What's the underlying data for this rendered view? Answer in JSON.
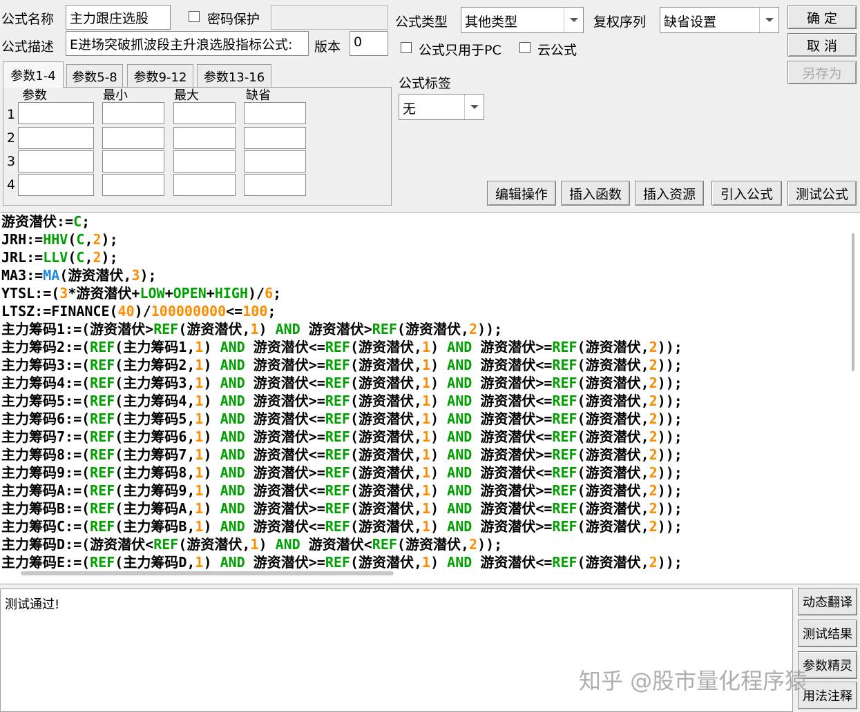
{
  "header": {
    "name_label": "公式名称",
    "name_value": "主力跟庄选股",
    "password_label": "密码保护",
    "password_value": "",
    "desc_label": "公式描述",
    "desc_value": "E进场突破抓波段主升浪选股指标公式:",
    "version_label": "版本",
    "version_value": "0",
    "type_label": "公式类型",
    "type_value": "其他类型",
    "rights_label": "复权序列",
    "rights_value": "缺省设置",
    "pc_only_label": "公式只用于PC",
    "cloud_label": "云公式",
    "tag_label": "公式标签",
    "tag_value": "无"
  },
  "buttons": {
    "ok": "确 定",
    "cancel": "取 消",
    "save_as": "另存为",
    "edit_op": "编辑操作",
    "insert_func": "插入函数",
    "insert_res": "插入资源",
    "import_formula": "引入公式",
    "test_formula": "测试公式"
  },
  "params": {
    "tabs": [
      "参数1-4",
      "参数5-8",
      "参数9-12",
      "参数13-16"
    ],
    "active_tab": 0,
    "col_headers": [
      "参数",
      "最小",
      "最大",
      "缺省"
    ],
    "rows": [
      "1",
      "2",
      "3",
      "4"
    ]
  },
  "code": {
    "colors": {
      "func": "#00a000",
      "num": "#ff8c00",
      "ma": "#1e88e5",
      "text": "#000000"
    },
    "lines": [
      [
        [
          "游资潜伏:=",
          "t"
        ],
        [
          "C",
          "f"
        ],
        [
          ";",
          "t"
        ]
      ],
      [
        [
          "JRH:=",
          "t"
        ],
        [
          "HHV",
          "f"
        ],
        [
          "(",
          "t"
        ],
        [
          "C",
          "f"
        ],
        [
          ",",
          "t"
        ],
        [
          "2",
          "n"
        ],
        [
          ");",
          "t"
        ]
      ],
      [
        [
          "JRL:=",
          "t"
        ],
        [
          "LLV",
          "f"
        ],
        [
          "(",
          "t"
        ],
        [
          "C",
          "f"
        ],
        [
          ",",
          "t"
        ],
        [
          "2",
          "n"
        ],
        [
          ");",
          "t"
        ]
      ],
      [
        [
          "MA3:=",
          "t"
        ],
        [
          "MA",
          "m"
        ],
        [
          "(游资潜伏,",
          "t"
        ],
        [
          "3",
          "n"
        ],
        [
          ");",
          "t"
        ]
      ],
      [
        [
          "YTSL:=(",
          "t"
        ],
        [
          "3",
          "n"
        ],
        [
          "*游资潜伏+",
          "t"
        ],
        [
          "LOW",
          "f"
        ],
        [
          "+",
          "t"
        ],
        [
          "OPEN",
          "f"
        ],
        [
          "+",
          "t"
        ],
        [
          "HIGH",
          "f"
        ],
        [
          ")/",
          "t"
        ],
        [
          "6",
          "n"
        ],
        [
          ";",
          "t"
        ]
      ],
      [
        [
          "LTSZ:=FINANCE(",
          "t"
        ],
        [
          "40",
          "n"
        ],
        [
          ")/",
          "t"
        ],
        [
          "100000000",
          "n"
        ],
        [
          "<=",
          "t"
        ],
        [
          "100",
          "n"
        ],
        [
          ";",
          "t"
        ]
      ],
      [
        [
          "主力筹码1:=(游资潜伏>",
          "t"
        ],
        [
          "REF",
          "f"
        ],
        [
          "(游资潜伏,",
          "t"
        ],
        [
          "1",
          "n"
        ],
        [
          ") ",
          "t"
        ],
        [
          "AND",
          "f"
        ],
        [
          " 游资潜伏>",
          "t"
        ],
        [
          "REF",
          "f"
        ],
        [
          "(游资潜伏,",
          "t"
        ],
        [
          "2",
          "n"
        ],
        [
          "));",
          "t"
        ]
      ],
      [
        [
          "主力筹码2:=(",
          "t"
        ],
        [
          "REF",
          "f"
        ],
        [
          "(主力筹码1,",
          "t"
        ],
        [
          "1",
          "n"
        ],
        [
          ") ",
          "t"
        ],
        [
          "AND",
          "f"
        ],
        [
          " 游资潜伏<=",
          "t"
        ],
        [
          "REF",
          "f"
        ],
        [
          "(游资潜伏,",
          "t"
        ],
        [
          "1",
          "n"
        ],
        [
          ") ",
          "t"
        ],
        [
          "AND",
          "f"
        ],
        [
          " 游资潜伏>=",
          "t"
        ],
        [
          "REF",
          "f"
        ],
        [
          "(游资潜伏,",
          "t"
        ],
        [
          "2",
          "n"
        ],
        [
          "));",
          "t"
        ]
      ],
      [
        [
          "主力筹码3:=(",
          "t"
        ],
        [
          "REF",
          "f"
        ],
        [
          "(主力筹码2,",
          "t"
        ],
        [
          "1",
          "n"
        ],
        [
          ") ",
          "t"
        ],
        [
          "AND",
          "f"
        ],
        [
          " 游资潜伏>=",
          "t"
        ],
        [
          "REF",
          "f"
        ],
        [
          "(游资潜伏,",
          "t"
        ],
        [
          "1",
          "n"
        ],
        [
          ") ",
          "t"
        ],
        [
          "AND",
          "f"
        ],
        [
          " 游资潜伏<=",
          "t"
        ],
        [
          "REF",
          "f"
        ],
        [
          "(游资潜伏,",
          "t"
        ],
        [
          "2",
          "n"
        ],
        [
          "));",
          "t"
        ]
      ],
      [
        [
          "主力筹码4:=(",
          "t"
        ],
        [
          "REF",
          "f"
        ],
        [
          "(主力筹码3,",
          "t"
        ],
        [
          "1",
          "n"
        ],
        [
          ") ",
          "t"
        ],
        [
          "AND",
          "f"
        ],
        [
          " 游资潜伏<=",
          "t"
        ],
        [
          "REF",
          "f"
        ],
        [
          "(游资潜伏,",
          "t"
        ],
        [
          "1",
          "n"
        ],
        [
          ") ",
          "t"
        ],
        [
          "AND",
          "f"
        ],
        [
          " 游资潜伏>=",
          "t"
        ],
        [
          "REF",
          "f"
        ],
        [
          "(游资潜伏,",
          "t"
        ],
        [
          "2",
          "n"
        ],
        [
          "));",
          "t"
        ]
      ],
      [
        [
          "主力筹码5:=(",
          "t"
        ],
        [
          "REF",
          "f"
        ],
        [
          "(主力筹码4,",
          "t"
        ],
        [
          "1",
          "n"
        ],
        [
          ") ",
          "t"
        ],
        [
          "AND",
          "f"
        ],
        [
          " 游资潜伏>=",
          "t"
        ],
        [
          "REF",
          "f"
        ],
        [
          "(游资潜伏,",
          "t"
        ],
        [
          "1",
          "n"
        ],
        [
          ") ",
          "t"
        ],
        [
          "AND",
          "f"
        ],
        [
          " 游资潜伏<=",
          "t"
        ],
        [
          "REF",
          "f"
        ],
        [
          "(游资潜伏,",
          "t"
        ],
        [
          "2",
          "n"
        ],
        [
          "));",
          "t"
        ]
      ],
      [
        [
          "主力筹码6:=(",
          "t"
        ],
        [
          "REF",
          "f"
        ],
        [
          "(主力筹码5,",
          "t"
        ],
        [
          "1",
          "n"
        ],
        [
          ") ",
          "t"
        ],
        [
          "AND",
          "f"
        ],
        [
          " 游资潜伏<=",
          "t"
        ],
        [
          "REF",
          "f"
        ],
        [
          "(游资潜伏,",
          "t"
        ],
        [
          "1",
          "n"
        ],
        [
          ") ",
          "t"
        ],
        [
          "AND",
          "f"
        ],
        [
          " 游资潜伏>=",
          "t"
        ],
        [
          "REF",
          "f"
        ],
        [
          "(游资潜伏,",
          "t"
        ],
        [
          "2",
          "n"
        ],
        [
          "));",
          "t"
        ]
      ],
      [
        [
          "主力筹码7:=(",
          "t"
        ],
        [
          "REF",
          "f"
        ],
        [
          "(主力筹码6,",
          "t"
        ],
        [
          "1",
          "n"
        ],
        [
          ") ",
          "t"
        ],
        [
          "AND",
          "f"
        ],
        [
          " 游资潜伏>=",
          "t"
        ],
        [
          "REF",
          "f"
        ],
        [
          "(游资潜伏,",
          "t"
        ],
        [
          "1",
          "n"
        ],
        [
          ") ",
          "t"
        ],
        [
          "AND",
          "f"
        ],
        [
          " 游资潜伏<=",
          "t"
        ],
        [
          "REF",
          "f"
        ],
        [
          "(游资潜伏,",
          "t"
        ],
        [
          "2",
          "n"
        ],
        [
          "));",
          "t"
        ]
      ],
      [
        [
          "主力筹码8:=(",
          "t"
        ],
        [
          "REF",
          "f"
        ],
        [
          "(主力筹码7,",
          "t"
        ],
        [
          "1",
          "n"
        ],
        [
          ") ",
          "t"
        ],
        [
          "AND",
          "f"
        ],
        [
          " 游资潜伏<=",
          "t"
        ],
        [
          "REF",
          "f"
        ],
        [
          "(游资潜伏,",
          "t"
        ],
        [
          "1",
          "n"
        ],
        [
          ") ",
          "t"
        ],
        [
          "AND",
          "f"
        ],
        [
          " 游资潜伏>=",
          "t"
        ],
        [
          "REF",
          "f"
        ],
        [
          "(游资潜伏,",
          "t"
        ],
        [
          "2",
          "n"
        ],
        [
          "));",
          "t"
        ]
      ],
      [
        [
          "主力筹码9:=(",
          "t"
        ],
        [
          "REF",
          "f"
        ],
        [
          "(主力筹码8,",
          "t"
        ],
        [
          "1",
          "n"
        ],
        [
          ") ",
          "t"
        ],
        [
          "AND",
          "f"
        ],
        [
          " 游资潜伏>=",
          "t"
        ],
        [
          "REF",
          "f"
        ],
        [
          "(游资潜伏,",
          "t"
        ],
        [
          "1",
          "n"
        ],
        [
          ") ",
          "t"
        ],
        [
          "AND",
          "f"
        ],
        [
          " 游资潜伏<=",
          "t"
        ],
        [
          "REF",
          "f"
        ],
        [
          "(游资潜伏,",
          "t"
        ],
        [
          "2",
          "n"
        ],
        [
          "));",
          "t"
        ]
      ],
      [
        [
          "主力筹码A:=(",
          "t"
        ],
        [
          "REF",
          "f"
        ],
        [
          "(主力筹码9,",
          "t"
        ],
        [
          "1",
          "n"
        ],
        [
          ") ",
          "t"
        ],
        [
          "AND",
          "f"
        ],
        [
          " 游资潜伏<=",
          "t"
        ],
        [
          "REF",
          "f"
        ],
        [
          "(游资潜伏,",
          "t"
        ],
        [
          "1",
          "n"
        ],
        [
          ") ",
          "t"
        ],
        [
          "AND",
          "f"
        ],
        [
          " 游资潜伏>=",
          "t"
        ],
        [
          "REF",
          "f"
        ],
        [
          "(游资潜伏,",
          "t"
        ],
        [
          "2",
          "n"
        ],
        [
          "));",
          "t"
        ]
      ],
      [
        [
          "主力筹码B:=(",
          "t"
        ],
        [
          "REF",
          "f"
        ],
        [
          "(主力筹码A,",
          "t"
        ],
        [
          "1",
          "n"
        ],
        [
          ") ",
          "t"
        ],
        [
          "AND",
          "f"
        ],
        [
          " 游资潜伏>=",
          "t"
        ],
        [
          "REF",
          "f"
        ],
        [
          "(游资潜伏,",
          "t"
        ],
        [
          "1",
          "n"
        ],
        [
          ") ",
          "t"
        ],
        [
          "AND",
          "f"
        ],
        [
          " 游资潜伏<=",
          "t"
        ],
        [
          "REF",
          "f"
        ],
        [
          "(游资潜伏,",
          "t"
        ],
        [
          "2",
          "n"
        ],
        [
          "));",
          "t"
        ]
      ],
      [
        [
          "主力筹码C:=(",
          "t"
        ],
        [
          "REF",
          "f"
        ],
        [
          "(主力筹码B,",
          "t"
        ],
        [
          "1",
          "n"
        ],
        [
          ") ",
          "t"
        ],
        [
          "AND",
          "f"
        ],
        [
          " 游资潜伏<=",
          "t"
        ],
        [
          "REF",
          "f"
        ],
        [
          "(游资潜伏,",
          "t"
        ],
        [
          "1",
          "n"
        ],
        [
          ") ",
          "t"
        ],
        [
          "AND",
          "f"
        ],
        [
          " 游资潜伏>=",
          "t"
        ],
        [
          "REF",
          "f"
        ],
        [
          "(游资潜伏,",
          "t"
        ],
        [
          "2",
          "n"
        ],
        [
          "));",
          "t"
        ]
      ],
      [
        [
          "主力筹码D:=(游资潜伏<",
          "t"
        ],
        [
          "REF",
          "f"
        ],
        [
          "(游资潜伏,",
          "t"
        ],
        [
          "1",
          "n"
        ],
        [
          ") ",
          "t"
        ],
        [
          "AND",
          "f"
        ],
        [
          " 游资潜伏<",
          "t"
        ],
        [
          "REF",
          "f"
        ],
        [
          "(游资潜伏,",
          "t"
        ],
        [
          "2",
          "n"
        ],
        [
          "));",
          "t"
        ]
      ],
      [
        [
          "主力筹码E:=(",
          "t"
        ],
        [
          "REF",
          "f"
        ],
        [
          "(主力筹码D,",
          "t"
        ],
        [
          "1",
          "n"
        ],
        [
          ") ",
          "t"
        ],
        [
          "AND",
          "f"
        ],
        [
          " 游资潜伏>=",
          "t"
        ],
        [
          "REF",
          "f"
        ],
        [
          "(游资潜伏,",
          "t"
        ],
        [
          "1",
          "n"
        ],
        [
          ") ",
          "t"
        ],
        [
          "AND",
          "f"
        ],
        [
          " 游资潜伏<=",
          "t"
        ],
        [
          "REF",
          "f"
        ],
        [
          "(游资潜伏,",
          "t"
        ],
        [
          "2",
          "n"
        ],
        [
          "));",
          "t"
        ]
      ]
    ]
  },
  "result": {
    "text": "测试通过!"
  },
  "side_buttons": [
    "动态翻译",
    "测试结果",
    "参数精灵",
    "用法注释"
  ],
  "watermark": "知乎 @股市量化程序猿"
}
